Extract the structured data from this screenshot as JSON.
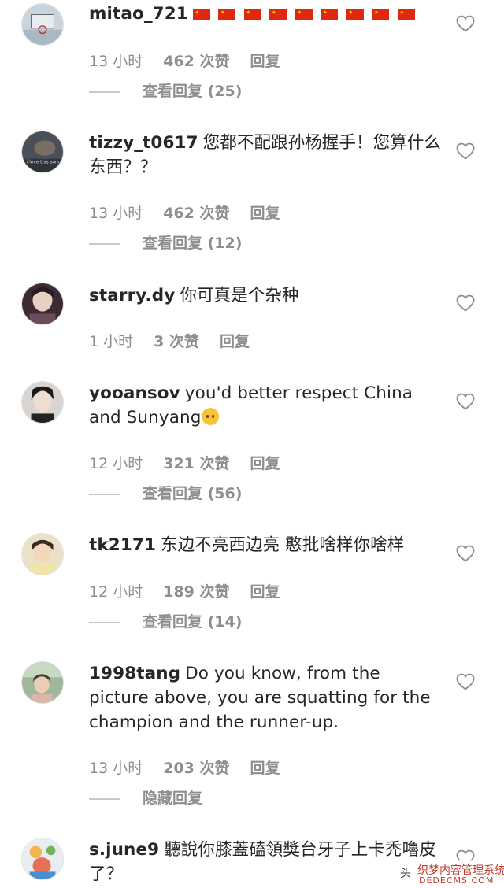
{
  "comments": [
    {
      "username": "mitao_721",
      "text": "",
      "has_flags": true,
      "flag_count": 9,
      "time": "13 小时",
      "likes": "462 次赞",
      "reply_label": "回复",
      "view_replies": "查看回复 (25)"
    },
    {
      "username": "tizzy_t0617",
      "text": "您都不配跟孙杨握手！您算什么东西？？",
      "time": "13 小时",
      "likes": "462 次赞",
      "reply_label": "回复",
      "view_replies": "查看回复 (12)",
      "avatar_caption": "i love this song"
    },
    {
      "username": "starry.dy",
      "text": "你可真是个杂种",
      "time": "1 小时",
      "likes": "3 次赞",
      "reply_label": "回复"
    },
    {
      "username": "yooansov",
      "text": "you'd better respect China and Sunyang",
      "emoji": "upside-down-face",
      "time": "12 小时",
      "likes": "321 次赞",
      "reply_label": "回复",
      "view_replies": "查看回复 (56)"
    },
    {
      "username": "tk2171",
      "text": "东边不亮西边亮 憨批啥样你啥样",
      "time": "12 小时",
      "likes": "189 次赞",
      "reply_label": "回复",
      "view_replies": "查看回复 (14)"
    },
    {
      "username": "1998tang",
      "text": "Do you know, from the picture above, you are squatting for the champion and the runner-up.",
      "time": "13 小时",
      "likes": "203 次赞",
      "reply_label": "回复",
      "view_replies": "隐藏回复"
    },
    {
      "username": "s.june9",
      "text": "聽說你膝蓋磕領獎台牙子上卡禿嚕皮了？"
    }
  ],
  "icons": {
    "like": "heart-outline-icon"
  },
  "colors": {
    "text": "#262626",
    "meta": "#8e8e8e",
    "divider": "#c7c7c7"
  },
  "watermark": {
    "prefix": "头",
    "title": "织梦内容管理系统",
    "domain": "DEDECMS.COM"
  }
}
